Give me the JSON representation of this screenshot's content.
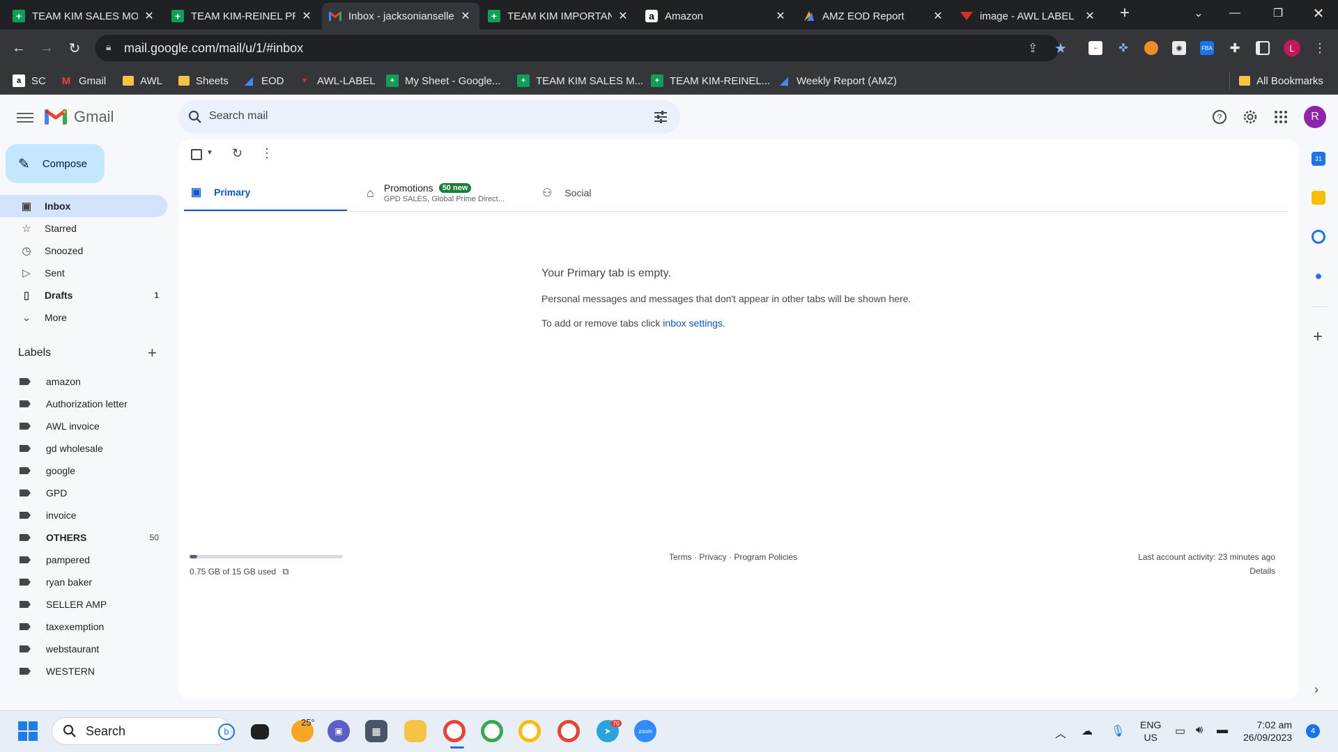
{
  "browser": {
    "tabs": [
      {
        "title": "TEAM KIM SALES MO",
        "icon": "sheets-icon"
      },
      {
        "title": "TEAM KIM-REINEL PR",
        "icon": "sheets-icon"
      },
      {
        "title": "Inbox - jacksonianseller",
        "icon": "gmail-icon",
        "active": true
      },
      {
        "title": "TEAM KIM IMPORTANT",
        "icon": "sheets-icon"
      },
      {
        "title": "Amazon",
        "icon": "amazon-icon"
      },
      {
        "title": "AMZ EOD Report",
        "icon": "report-icon"
      },
      {
        "title": "image - AWL LABEL",
        "icon": "awl-icon"
      }
    ],
    "url": "mail.google.com/mail/u/1/#inbox",
    "profile_initial": "L",
    "bookmarks": [
      {
        "label": "SC"
      },
      {
        "label": "Gmail"
      },
      {
        "label": "AWL"
      },
      {
        "label": "Sheets"
      },
      {
        "label": "EOD"
      },
      {
        "label": "AWL-LABEL"
      },
      {
        "label": "My Sheet - Google..."
      },
      {
        "label": "TEAM KIM SALES M..."
      },
      {
        "label": "TEAM KIM-REINEL..."
      },
      {
        "label": "Weekly Report (AMZ)"
      }
    ],
    "all_bookmarks": "All Bookmarks"
  },
  "gmail": {
    "brand": "Gmail",
    "search_placeholder": "Search mail",
    "account_initial": "R",
    "compose": "Compose",
    "nav": [
      {
        "label": "Inbox",
        "icon": "inbox-icon",
        "count": ""
      },
      {
        "label": "Starred",
        "icon": "star-icon",
        "count": ""
      },
      {
        "label": "Snoozed",
        "icon": "clock-icon",
        "count": ""
      },
      {
        "label": "Sent",
        "icon": "send-icon",
        "count": ""
      },
      {
        "label": "Drafts",
        "icon": "draft-icon",
        "count": "1"
      },
      {
        "label": "More",
        "icon": "chevron-down-icon",
        "count": ""
      }
    ],
    "labels_title": "Labels",
    "labels": [
      {
        "label": "amazon",
        "count": ""
      },
      {
        "label": "Authorization letter",
        "count": ""
      },
      {
        "label": "AWL invoice",
        "count": ""
      },
      {
        "label": "gd wholesale",
        "count": ""
      },
      {
        "label": "google",
        "count": ""
      },
      {
        "label": "GPD",
        "count": ""
      },
      {
        "label": "invoice",
        "count": ""
      },
      {
        "label": "OTHERS",
        "count": "50"
      },
      {
        "label": "pampered",
        "count": ""
      },
      {
        "label": "ryan baker",
        "count": ""
      },
      {
        "label": "SELLER AMP",
        "count": ""
      },
      {
        "label": "taxexemption",
        "count": ""
      },
      {
        "label": "webstaurant",
        "count": ""
      },
      {
        "label": "WESTERN",
        "count": ""
      }
    ],
    "tabs": {
      "primary": "Primary",
      "promotions": "Promotions",
      "promotions_badge": "50 new",
      "promotions_sub": "GPD SALES, Global Prime Direct...",
      "social": "Social"
    },
    "empty": {
      "title": "Your Primary tab is empty.",
      "message": "Personal messages and messages that don't appear in other tabs will be shown here.",
      "settings_prefix": "To add or remove tabs click ",
      "settings_link": "inbox settings",
      "settings_suffix": "."
    },
    "storage": {
      "text": "0.75 GB of 15 GB used",
      "used_fraction": 0.05
    },
    "footer": {
      "terms": "Terms",
      "privacy": "Privacy",
      "policies": "Program Policies",
      "sep": " · "
    },
    "activity": "Last account activity: 23 minutes ago",
    "details": "Details"
  },
  "taskbar": {
    "search": "Search",
    "weather": "25°",
    "lang_top": "ENG",
    "lang_bottom": "US",
    "time": "7:02 am",
    "date": "26/09/2023",
    "notification_count": "4",
    "telegram_badge": "76"
  }
}
